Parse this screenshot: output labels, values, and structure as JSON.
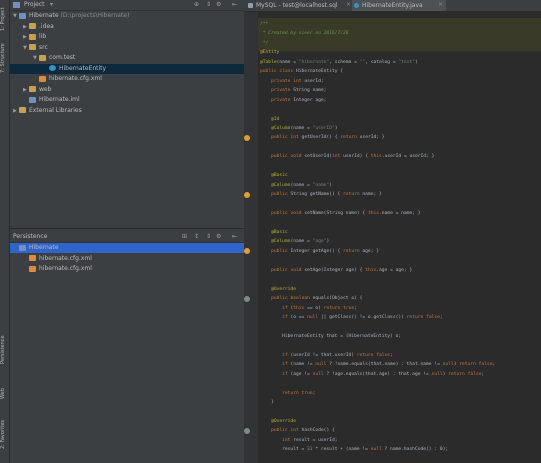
{
  "project_panel": {
    "title": "Project",
    "tree": [
      {
        "label": "Hibernate",
        "path": "(D:\\projects\\Hibernate)",
        "kind": "module",
        "depth": 0,
        "expanded": true
      },
      {
        "label": ".idea",
        "kind": "folder",
        "depth": 1,
        "expanded": false
      },
      {
        "label": "lib",
        "kind": "folder",
        "depth": 1,
        "expanded": false
      },
      {
        "label": "src",
        "kind": "folder",
        "depth": 1,
        "expanded": true
      },
      {
        "label": "com.test",
        "kind": "folder",
        "depth": 2,
        "expanded": true
      },
      {
        "label": "HibernateEntity",
        "kind": "class",
        "depth": 3,
        "selected": true
      },
      {
        "label": "hibernate.cfg.xml",
        "kind": "xml",
        "depth": 2
      },
      {
        "label": "web",
        "kind": "folder",
        "depth": 1,
        "expanded": false
      },
      {
        "label": "Hibernate.iml",
        "kind": "iml",
        "depth": 1
      },
      {
        "label": "External Libraries",
        "kind": "lib",
        "depth": 0,
        "expanded": false
      }
    ]
  },
  "persistence_panel": {
    "title": "Persistence",
    "tree": [
      {
        "label": "Hibernate",
        "kind": "module",
        "depth": 0
      },
      {
        "label": "hibernate.cfg.xml",
        "kind": "xml",
        "depth": 1
      },
      {
        "label": "hibernate.cfg.xml",
        "kind": "xml",
        "depth": 1
      }
    ]
  },
  "side_tabs": [
    "1: Project",
    "7: Structure",
    "Persistence",
    "Web",
    "2: Favorites"
  ],
  "editor_tabs": [
    {
      "label": "MySQL - test@localhost.sql",
      "active": false
    },
    {
      "label": "HibernateEntity.java",
      "active": true
    }
  ],
  "code_lines": [
    {
      "t": "/**",
      "c": "cm"
    },
    {
      "t": " * Created by sieer on 2016/7/26",
      "c": "cm"
    },
    {
      "t": " */",
      "c": "cm"
    },
    {
      "t": "@Entity",
      "c": "an"
    },
    {
      "t": "@Table(name = \"hibernate\", schema = \"\", catalog = \"test\")",
      "c": "mix1"
    },
    {
      "t": "public class HibernateEntity {",
      "c": "mix2"
    },
    {
      "t": "    private int userId;",
      "c": "mix3"
    },
    {
      "t": "    private String name;",
      "c": "mix3"
    },
    {
      "t": "    private Integer age;",
      "c": "mix3"
    },
    {
      "t": "",
      "c": ""
    },
    {
      "t": "    @Id",
      "c": "an"
    },
    {
      "t": "    @Column(name = \"userID\")",
      "c": "mix4"
    },
    {
      "t": "    public int getUserId() { return userId; }",
      "c": "mix5"
    },
    {
      "t": "",
      "c": ""
    },
    {
      "t": "    public void setUserId(int userId) { this.userId = userId; }",
      "c": "mix5"
    },
    {
      "t": "",
      "c": ""
    },
    {
      "t": "    @Basic",
      "c": "an"
    },
    {
      "t": "    @Column(name = \"name\")",
      "c": "mix4"
    },
    {
      "t": "    public String getName() { return name; }",
      "c": "mix5"
    },
    {
      "t": "",
      "c": ""
    },
    {
      "t": "    public void setName(String name) { this.name = name; }",
      "c": "mix5"
    },
    {
      "t": "",
      "c": ""
    },
    {
      "t": "    @Basic",
      "c": "an"
    },
    {
      "t": "    @Column(name = \"age\")",
      "c": "mix4"
    },
    {
      "t": "    public Integer getAge() { return age; }",
      "c": "mix5"
    },
    {
      "t": "",
      "c": ""
    },
    {
      "t": "    public void setAge(Integer age) { this.age = age; }",
      "c": "mix5"
    },
    {
      "t": "",
      "c": ""
    },
    {
      "t": "    @Override",
      "c": "an"
    },
    {
      "t": "    public boolean equals(Object o) {",
      "c": "mix5"
    },
    {
      "t": "        if (this == o) return true;",
      "c": "mix5"
    },
    {
      "t": "        if (o == null || getClass() != o.getClass()) return false;",
      "c": "mix5"
    },
    {
      "t": "",
      "c": ""
    },
    {
      "t": "        HibernateEntity that = (HibernateEntity) o;",
      "c": ""
    },
    {
      "t": "",
      "c": ""
    },
    {
      "t": "        if (userId != that.userId) return false;",
      "c": "mix5"
    },
    {
      "t": "        if (name != null ? !name.equals(that.name) : that.name != null) return false;",
      "c": "mix5"
    },
    {
      "t": "        if (age != null ? !age.equals(that.age) : that.age != null) return false;",
      "c": "mix5"
    },
    {
      "t": "",
      "c": ""
    },
    {
      "t": "        return true;",
      "c": "mix5"
    },
    {
      "t": "    }",
      "c": ""
    },
    {
      "t": "",
      "c": ""
    },
    {
      "t": "    @Override",
      "c": "an"
    },
    {
      "t": "    public int hashCode() {",
      "c": "mix5"
    },
    {
      "t": "        int result = userId;",
      "c": "mix5"
    },
    {
      "t": "        result = 31 * result + (name != null ? name.hashCode() : 0);",
      "c": "mix5"
    }
  ],
  "colors": {
    "keyword": "#cc7832",
    "annotation": "#bbb529",
    "string": "#6a8759",
    "comment": "#629755",
    "selection": "#0d293e",
    "persistence_selection": "#2f65ca"
  }
}
